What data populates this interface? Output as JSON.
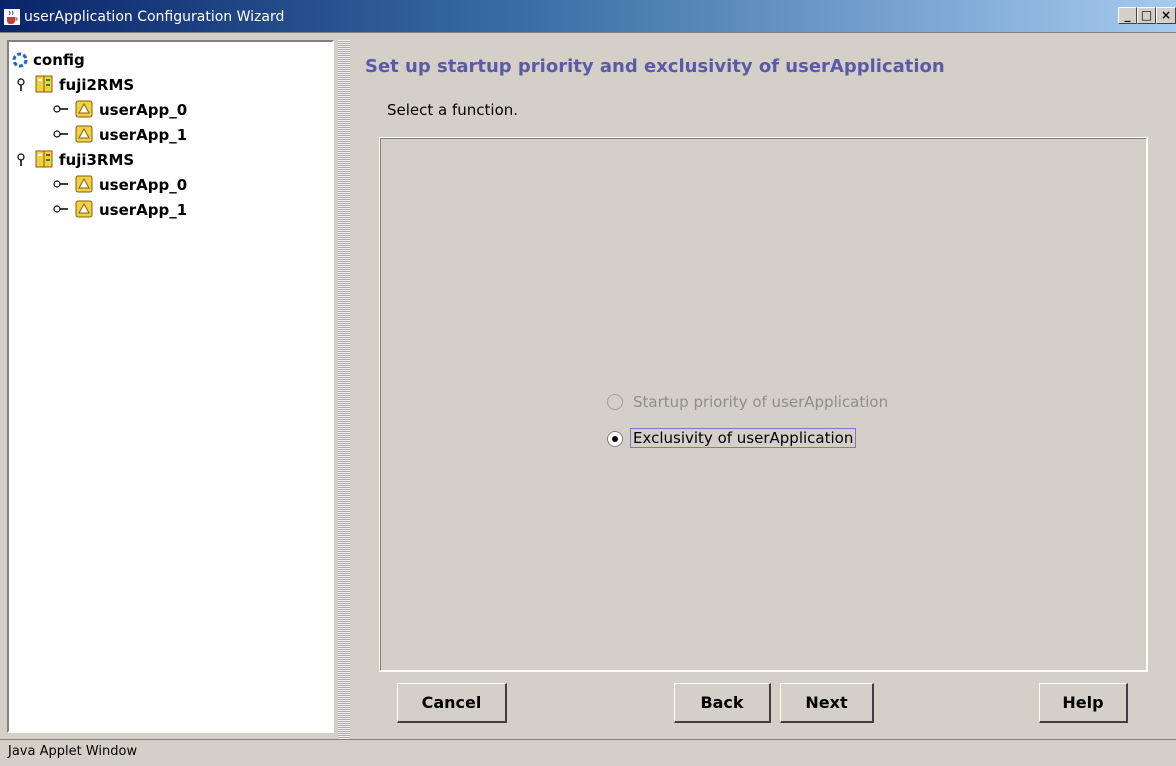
{
  "window": {
    "title": "userApplication Configuration Wizard",
    "minimize_label": "_",
    "maximize_label": "□",
    "close_label": "×"
  },
  "tree": {
    "root": {
      "label": "config",
      "icon": "config-icon"
    },
    "nodes": [
      {
        "label": "fuji2RMS",
        "icon": "node-icon",
        "children": [
          "userApp_0",
          "userApp_1"
        ]
      },
      {
        "label": "fuji3RMS",
        "icon": "node-icon",
        "children": [
          "userApp_0",
          "userApp_1"
        ]
      }
    ]
  },
  "main": {
    "heading": "Set up startup priority and exclusivity of userApplication",
    "subheading": "Select a function.",
    "options": [
      {
        "label": "Startup priority of userApplication",
        "selected": false,
        "enabled": false
      },
      {
        "label": "Exclusivity of userApplication",
        "selected": true,
        "enabled": true
      }
    ]
  },
  "buttons": {
    "cancel": "Cancel",
    "back": "Back",
    "next": "Next",
    "help": "Help"
  },
  "status": {
    "text": "Java Applet Window"
  },
  "colors": {
    "heading": "#5a5aa8",
    "background": "#d4d0c8",
    "folder": "#f2d040"
  }
}
